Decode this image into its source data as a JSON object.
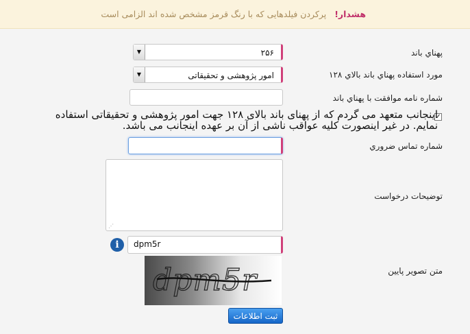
{
  "warning": {
    "title": "هشدار!",
    "message": "پرکردن فیلدهایی که با رنگ قرمز مشخص شده اند الزامی است"
  },
  "form": {
    "bandwidth": {
      "label": "پهناي باند",
      "value": "۲۵۶"
    },
    "usage": {
      "label": "مورد استفاده پهناي باند بالاي ۱۲۸",
      "value": "امور پژوهشی و تحقیقاتی"
    },
    "approval_letter": {
      "label": "شماره نامه موافقت با پهناي باند",
      "value": ""
    },
    "agreement": {
      "checked": true,
      "text": "اینجانب متعهد می گردم که از پهنای باند بالای ۱۲۸ جهت امور پژوهشی و تحقیقاتی استفاده  نمایم. در غیر اینصورت کلیه  عواقب  ناشی  از  آن  بر عهده اینجانب می باشد."
    },
    "emergency_phone": {
      "label": "شماره تماس ضروري",
      "value": ""
    },
    "description": {
      "label": "توضیحات درخواست",
      "value": ""
    },
    "captcha": {
      "label": "متن تصویر پایین",
      "value": "dpm5r",
      "image_text": "dpm5r"
    },
    "submit_label": "ثبت اطلاعات"
  },
  "colors": {
    "required_accent": "#d0407a",
    "warning_bg": "#fbf3dd",
    "submit_bg": "#1f7ad8"
  }
}
